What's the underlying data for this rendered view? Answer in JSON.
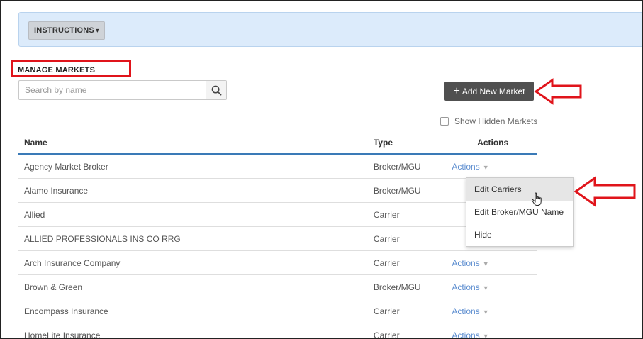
{
  "instructions": {
    "label": "INSTRUCTIONS",
    "chevron": "▾"
  },
  "page": {
    "title": "MANAGE MARKETS"
  },
  "search": {
    "placeholder": "Search by name",
    "value": ""
  },
  "add_button": {
    "plus": "+",
    "label": "Add New Market"
  },
  "show_hidden": {
    "label": "Show Hidden Markets",
    "checked": false
  },
  "table": {
    "headers": {
      "name": "Name",
      "type": "Type",
      "actions": "Actions"
    },
    "rows": [
      {
        "name": "Agency Market Broker",
        "type": "Broker/MGU",
        "actions": "Actions"
      },
      {
        "name": "Alamo Insurance",
        "type": "Broker/MGU",
        "actions": ""
      },
      {
        "name": "Allied",
        "type": "Carrier",
        "actions": ""
      },
      {
        "name": "ALLIED PROFESSIONALS INS CO RRG",
        "type": "Carrier",
        "actions": ""
      },
      {
        "name": "Arch Insurance Company",
        "type": "Carrier",
        "actions": "Actions"
      },
      {
        "name": "Brown & Green",
        "type": "Broker/MGU",
        "actions": "Actions"
      },
      {
        "name": "Encompass Insurance",
        "type": "Carrier",
        "actions": "Actions"
      },
      {
        "name": "HomeLite Insurance",
        "type": "Carrier",
        "actions": "Actions"
      }
    ]
  },
  "dropdown": {
    "items": [
      "Edit Carriers",
      "Edit Broker/MGU Name",
      "Hide"
    ]
  },
  "colors": {
    "annotation_red": "#e0141b",
    "link_blue": "#5d8ed0",
    "header_rule": "#3a7ab7"
  }
}
